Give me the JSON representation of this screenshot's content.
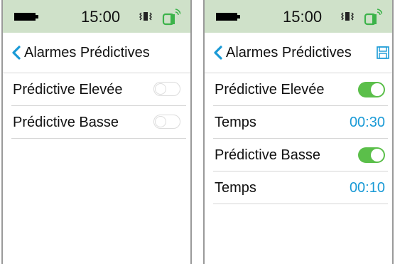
{
  "screens": [
    {
      "status": {
        "time": "15:00"
      },
      "title": "Alarmes Prédictives",
      "rows": [
        {
          "label": "Prédictive Elevée",
          "toggle": "off"
        },
        {
          "label": "Prédictive Basse",
          "toggle": "off"
        }
      ]
    },
    {
      "status": {
        "time": "15:00"
      },
      "title": "Alarmes Prédictives",
      "rows": [
        {
          "label": "Prédictive Elevée",
          "toggle": "on"
        },
        {
          "label": "Temps",
          "value": "00:30"
        },
        {
          "label": "Prédictive Basse",
          "toggle": "on"
        },
        {
          "label": "Temps",
          "value": "00:10"
        }
      ]
    }
  ],
  "colors": {
    "status_bar": "#cfe1c9",
    "accent": "#1a9ad6",
    "toggle_on": "#5bbf4a",
    "device_green": "#3cb34a"
  },
  "icons": [
    "battery-icon",
    "vibrate-icon",
    "device-connected-icon",
    "back-chevron-icon",
    "save-icon"
  ]
}
